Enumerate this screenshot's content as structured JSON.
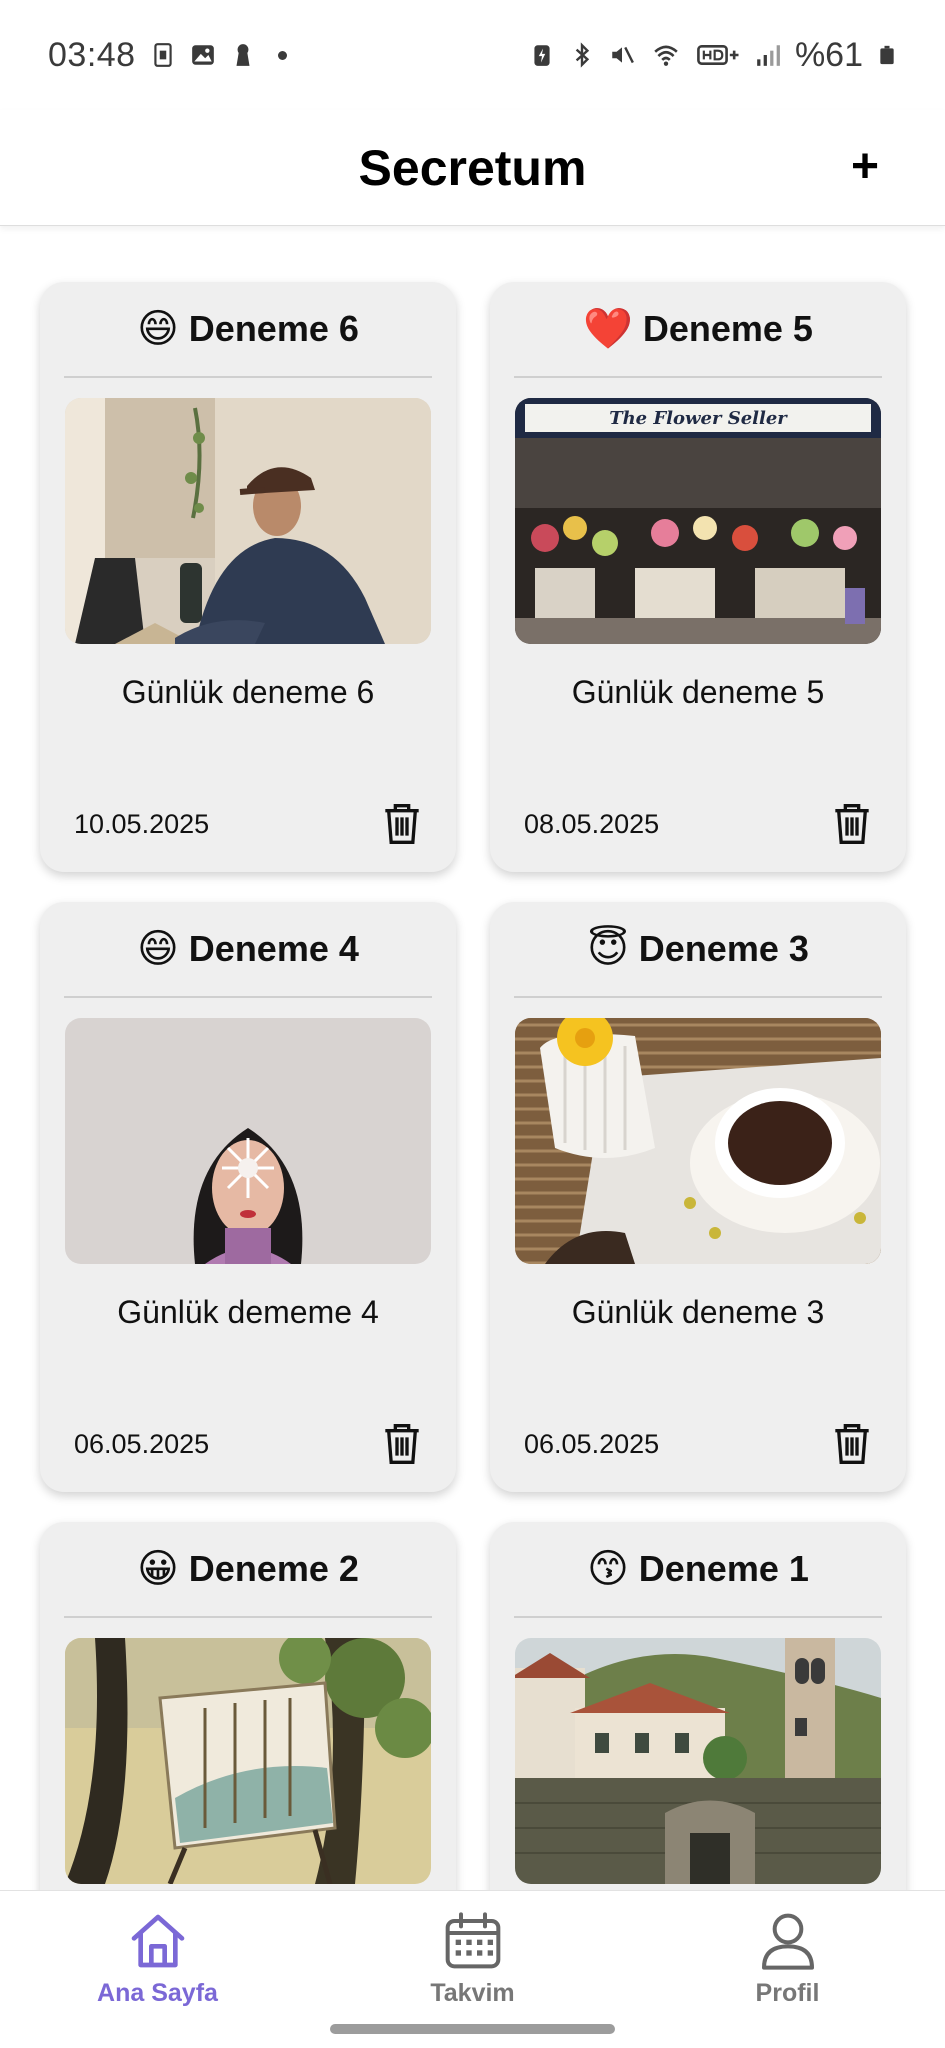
{
  "status_bar": {
    "time": "03:48",
    "battery": "%61"
  },
  "header": {
    "title": "Secretum",
    "add_label": "+"
  },
  "entries": [
    {
      "emoji": "😄",
      "title": "Deneme 6",
      "description": "Günlük deneme 6",
      "date": "10.05.2025",
      "photo": "man-at-laptop-photo"
    },
    {
      "emoji": "❤️",
      "title": "Deneme 5",
      "description": "Günlük deneme 5",
      "date": "08.05.2025",
      "photo": "flower-shop-photo",
      "sign_text": "The Flower Seller"
    },
    {
      "emoji": "😄",
      "title": "Deneme 4",
      "description": "Günlük dememe 4",
      "date": "06.05.2025",
      "photo": "woman-snowflake-photo"
    },
    {
      "emoji": "😇",
      "title": "Deneme 3",
      "description": "Günlük deneme 3",
      "date": "06.05.2025",
      "photo": "coffee-cup-photo"
    },
    {
      "emoji": "😀",
      "title": "Deneme 2",
      "description": "",
      "date": "",
      "photo": "painting-easel-photo"
    },
    {
      "emoji": "😙",
      "title": "Deneme 1",
      "description": "",
      "date": "",
      "photo": "old-town-tower-photo"
    }
  ],
  "nav": {
    "items": [
      {
        "label": "Ana Sayfa",
        "icon": "home-icon",
        "active": true
      },
      {
        "label": "Takvim",
        "icon": "calendar-icon",
        "active": false
      },
      {
        "label": "Profil",
        "icon": "profile-icon",
        "active": false
      }
    ]
  },
  "colors": {
    "accent": "#7b68d6",
    "card_bg": "#efefef",
    "nav_inactive": "#777777"
  }
}
